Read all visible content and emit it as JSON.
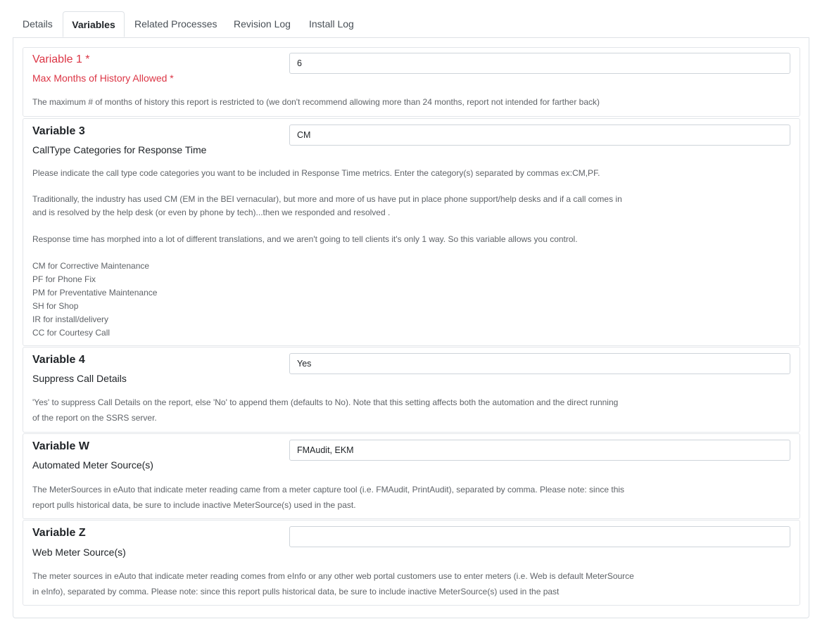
{
  "tabs": {
    "details": "Details",
    "variables": "Variables",
    "related_processes": "Related Processes",
    "revision_log": "Revision Log",
    "install_log": "Install Log"
  },
  "variables": [
    {
      "title": "Variable 1 *",
      "subtitle": "Max Months of History Allowed *",
      "value": "6",
      "description": [
        "The maximum # of months of history this report is restricted to (we don't recommend allowing more than 24 months, report not intended for farther back)"
      ]
    },
    {
      "title": "Variable 3",
      "subtitle": "CallType Categories for Response Time",
      "value": "CM",
      "description": [
        "Please indicate the call type code categories you want to be included in Response Time metrics.  Enter the category(s) separated by commas ex:CM,PF.",
        "",
        "Traditionally, the industry has used CM (EM in the BEI vernacular), but more and more of us have put in place phone support/help desks and if a call comes in",
        "and is resolved by the help desk (or even by phone by tech)...then we responded and resolved .",
        "",
        "Response time has morphed into a lot of different translations, and we aren't going to tell clients it's only 1 way. So this variable allows you control.",
        "",
        "CM for Corrective Maintenance",
        "PF for Phone Fix",
        "PM for Preventative Maintenance",
        "SH for Shop",
        "IR for install/delivery",
        "CC for Courtesy Call"
      ]
    },
    {
      "title": "Variable 4",
      "subtitle": "Suppress Call Details",
      "value": "Yes",
      "description": [
        "'Yes' to suppress Call Details on the report, else 'No' to append them (defaults to No). Note that this setting affects both the automation and the direct running",
        "of the report on the SSRS server."
      ]
    },
    {
      "title": "Variable W",
      "subtitle": "Automated Meter Source(s)",
      "value": "FMAudit, EKM",
      "description": [
        "The MeterSources in eAuto that indicate meter reading came from a meter capture tool (i.e. FMAudit, PrintAudit), separated by comma. Please note: since this",
        "report pulls historical data, be sure to include inactive MeterSource(s) used in the past."
      ]
    },
    {
      "title": "Variable Z",
      "subtitle": "Web Meter Source(s)",
      "value": "",
      "description": [
        "The meter sources in eAuto that indicate meter reading comes from eInfo or any other web portal customers use to enter meters (i.e. Web is default MeterSource",
        "in eInfo), separated by comma. Please note: since this report pulls historical data, be sure to include inactive MeterSource(s) used in the past"
      ]
    }
  ]
}
